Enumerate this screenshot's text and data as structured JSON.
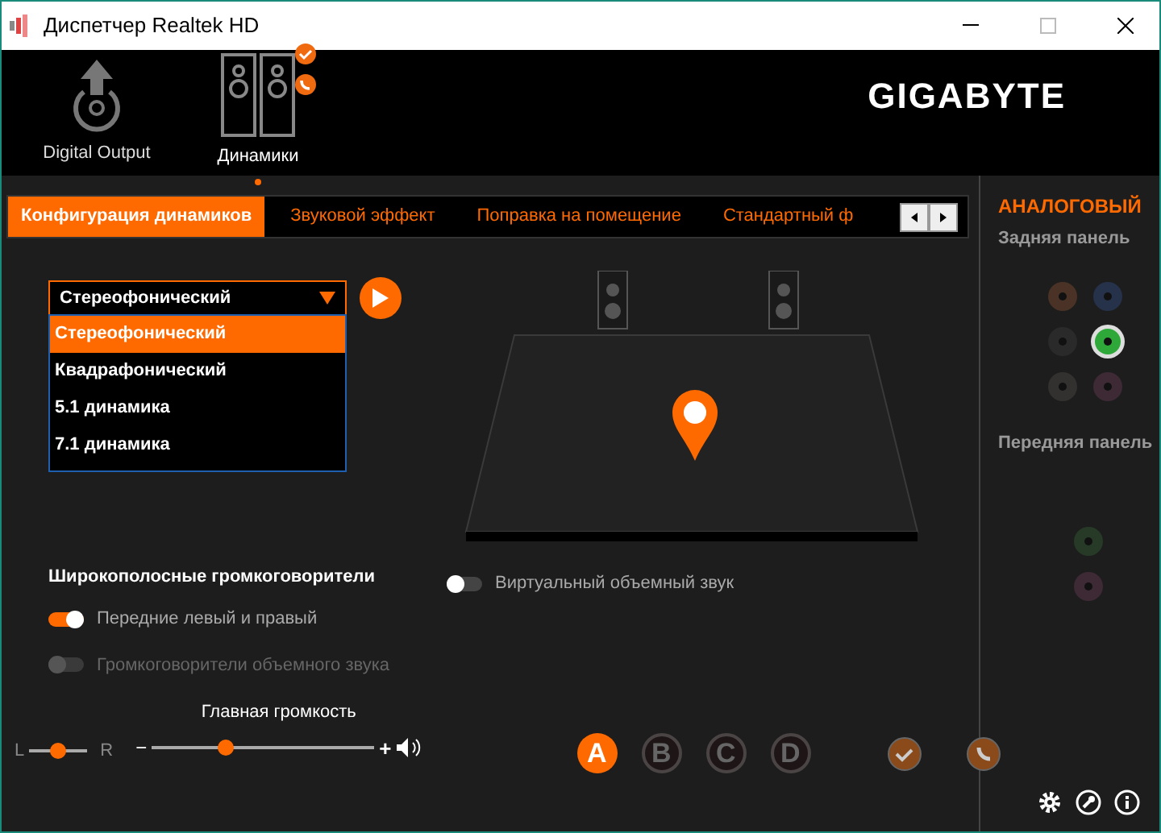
{
  "window": {
    "title": "Диспетчер Realtek HD"
  },
  "devices": [
    {
      "label": "Digital Output",
      "selected": false,
      "kind": "digital"
    },
    {
      "label": "Динамики",
      "selected": true,
      "kind": "speakers"
    }
  ],
  "brand": "GIGABYTE",
  "tabs": [
    {
      "label": "Конфигурация динамиков",
      "selected": true
    },
    {
      "label": "Звуковой эффект",
      "selected": false
    },
    {
      "label": "Поправка на помещение",
      "selected": false
    },
    {
      "label": "Стандартный ф",
      "selected": false
    }
  ],
  "config": {
    "value": "Стереофонический",
    "expanded": true,
    "options": [
      {
        "label": "Стереофонический",
        "selected": true
      },
      {
        "label": "Квадрафонический",
        "selected": false
      },
      {
        "label": "5.1 динамика",
        "selected": false
      },
      {
        "label": "7.1 динамика",
        "selected": false
      }
    ]
  },
  "fullrange": {
    "title": "Широкополосные громкоговорители",
    "toggles": [
      {
        "label": "Передние левый и правый",
        "on": true,
        "disabled": false
      },
      {
        "label": "Громкоговорители объемного звука",
        "on": false,
        "disabled": true
      }
    ]
  },
  "virtual_surround": {
    "label": "Виртуальный объемный звук",
    "on": false
  },
  "balance": {
    "left": "L",
    "right": "R",
    "level": 0.5
  },
  "volume": {
    "title": "Главная громкость",
    "minus": "−",
    "plus": "+",
    "level": 0.33
  },
  "profiles": [
    {
      "label": "A",
      "selected": true
    },
    {
      "label": "B",
      "selected": false
    },
    {
      "label": "C",
      "selected": false
    },
    {
      "label": "D",
      "selected": false
    }
  ],
  "analog": {
    "title": "АНАЛОГОВЫЙ",
    "rear_label": "Задняя панель",
    "rear_jacks": [
      {
        "color": "#4a3326",
        "active": false
      },
      {
        "color": "#26324a",
        "active": false
      },
      {
        "color": "#2a2a2a",
        "active": false
      },
      {
        "color": "#2fa83a",
        "active": true
      },
      {
        "color": "#333030",
        "active": false
      },
      {
        "color": "#3d2a35",
        "active": false
      }
    ],
    "front_label": "Передняя панель",
    "front_jacks": [
      {
        "color": "#273a27",
        "active": false
      },
      {
        "color": "#3d2a35",
        "active": false
      }
    ]
  }
}
